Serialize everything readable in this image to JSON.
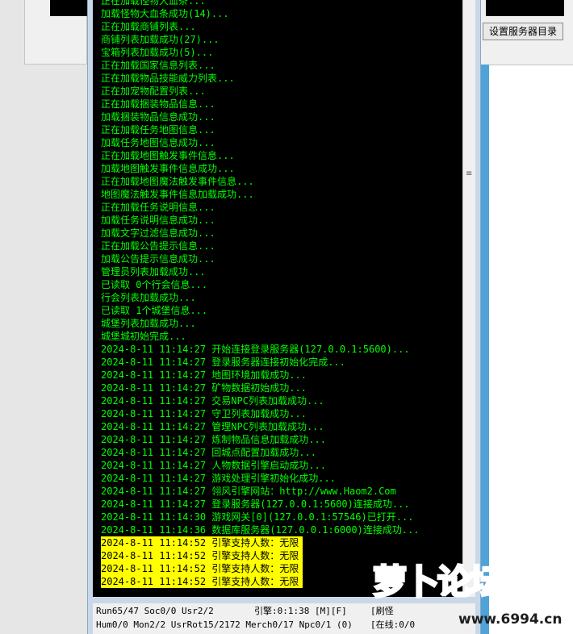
{
  "right_dialog": {
    "button_label": "设置服务器目录"
  },
  "log": {
    "lines": [
      "正在加载怪物大血条...",
      "加载怪物大血条成功(14)...",
      "正在加载商铺列表...",
      "商铺列表加载成功(27)...",
      "宝箱列表加载成功(5)...",
      "正在加载国家信息列表...",
      "正在加载物品技能威力列表...",
      "正在加宠物配置列表...",
      "正在加载捆装物品信息...",
      "加载捆装物品信息成功...",
      "正在加载任务地图信息...",
      "加载任务地图信息成功...",
      "正在加载地图触发事件信息...",
      "加载地图触发事件信息成功...",
      "正在加载地图魔法触发事件信息...",
      "地图魔法触发事件信息加载成功...",
      "正在加载任务说明信息...",
      "加载任务说明信息成功...",
      "加载文字过滤信息成功...",
      "正在加载公告提示信息...",
      "加载公告提示信息成功...",
      "管理员列表加载成功...",
      "已读取 0个行会信息...",
      "行会列表加载成功...",
      "已读取 1个城堡信息...",
      "城堡列表加载成功...",
      "城堡城初始完成...",
      "2024-8-11 11:14:27 开始连接登录服务器(127.0.0.1:5600)...",
      "2024-8-11 11:14:27 登录服务器连接初始化完成...",
      "2024-8-11 11:14:27 地图环境加载成功...",
      "2024-8-11 11:14:27 矿物数据初始成功...",
      "2024-8-11 11:14:27 交易NPC列表加载成功...",
      "2024-8-11 11:14:27 守卫列表加载成功...",
      "2024-8-11 11:14:27 管理NPC列表加载成功...",
      "2024-8-11 11:14:27 炼制物品信息加载成功...",
      "2024-8-11 11:14:27 回城点配置加载成功...",
      "2024-8-11 11:14:27 人物数据引擎启动成功...",
      "2024-8-11 11:14:27 游戏处理引擎初始化成功...",
      "2024-8-11 11:14:27 翎风引擎网站：http://www.Haom2.Com",
      "2024-8-11 11:14:27 登录服务器(127.0.0.1:5600)连接成功...",
      "2024-8-11 11:14:30 游戏网关[0](127.0.0.1:57546)已打开...",
      "2024-8-11 11:14:36 数据库服务器(127.0.0.1:6000)连接成功..."
    ],
    "highlight_lines": [
      "2024-8-11 11:14:52 引擎支持人数：无限",
      "2024-8-11 11:14:52 引擎支持人数：无限",
      "2024-8-11 11:14:52 引擎支持人数：无限",
      "2024-8-11 11:14:52 引擎支持人数：无限"
    ]
  },
  "status": {
    "run": "Run65/47 Soc0/0 Usr2/2",
    "engine": "引擎:0:1:38 [M][F]",
    "refresh": "[刷怪",
    "hum": "Hum0/0 Mon2/2 UsrRot15/2172 Merch0/17 Npc0/1 (0)",
    "online": "[在线:0/0"
  },
  "watermark": {
    "logo": "萝卜论坛",
    "url": "www.6994.cn"
  },
  "colors": {
    "log_text": "#00ff00",
    "highlight": "#ffff00",
    "log_bg": "#000000"
  }
}
